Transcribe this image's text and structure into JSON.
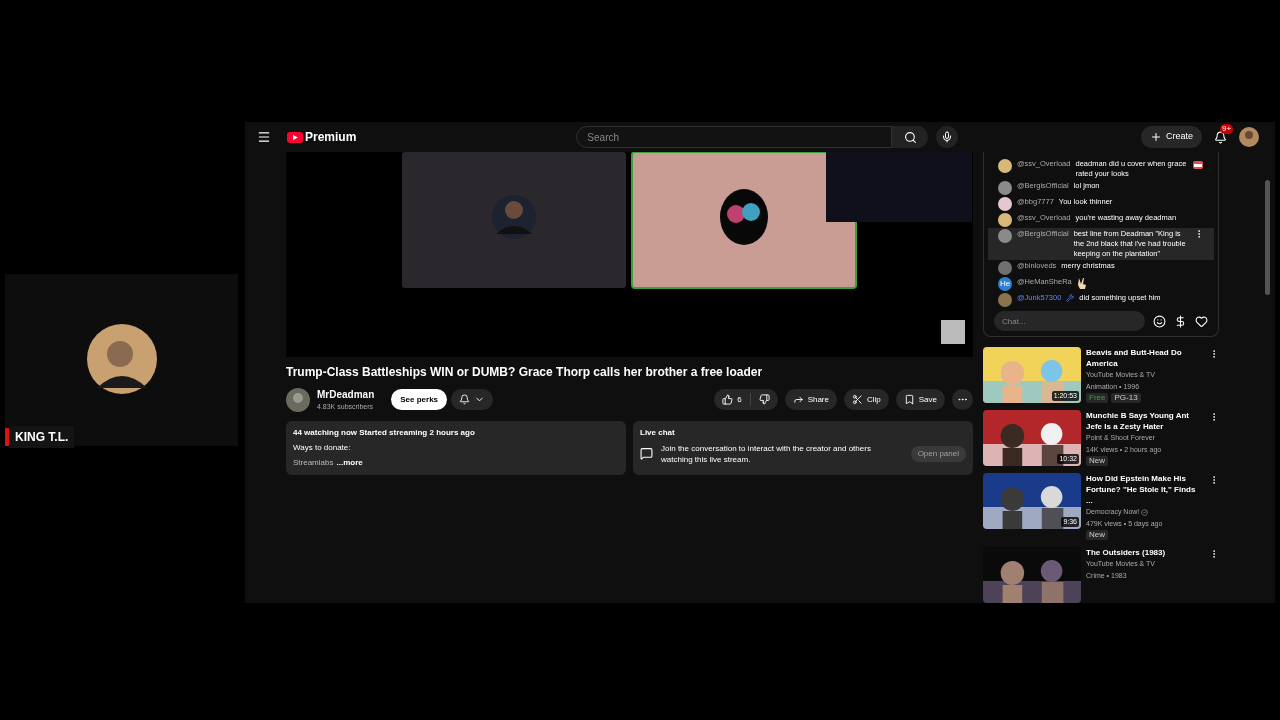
{
  "webcam": {
    "name": "KING T.L."
  },
  "header": {
    "logo": "Premium",
    "search": {
      "placeholder": "Search"
    },
    "create": "Create",
    "notifications": "9+"
  },
  "video": {
    "title": "Trump-Class Battleships WIN or DUMB? Grace Thorp calls her brother a free loader",
    "channel": "MrDeadman",
    "subscribers": "4.83K subscribers",
    "perks": "See perks",
    "likes": "6",
    "actions": [
      "Share",
      "Clip",
      "Save"
    ]
  },
  "description": {
    "stats": "44 watching now  Started streaming 2 hours ago",
    "line": "Ways to donate:",
    "preview": "Streamlabs",
    "more": "...more"
  },
  "live_chat_card": {
    "title": "Live chat",
    "text": "Join the conversation to interact with the creator and others watching this live stream.",
    "button": "Open panel",
    "disabled": true
  },
  "chat": {
    "messages": [
      {
        "author": "@ssv_Overload",
        "text": "deadman did u cover when grace rated your looks",
        "emoji": true,
        "color": "#d8b878",
        "selected": false
      },
      {
        "author": "@BergisOfficial",
        "text": "lol jmon",
        "color": "#8a8a8a",
        "selected": false
      },
      {
        "author": "@bbg7777",
        "text": "You look thinner",
        "color": "#e6c6d0",
        "selected": false
      },
      {
        "author": "@ssv_Overload",
        "text": "you're wasting away deadman",
        "color": "#d8b878",
        "selected": false
      },
      {
        "author": "@BergisOfficial",
        "text": "best line from Deadman \"King is the 2nd black that i've had trouble keeping on the plantation\"",
        "color": "#8a8a8a",
        "selected": true
      },
      {
        "author": "@binloveds",
        "text": "merry christmas",
        "color": "#707070",
        "selected": false
      },
      {
        "author": "@HeManSheRa",
        "initials": "He",
        "emoji": true,
        "color": "#2f7fd0",
        "selected": false
      },
      {
        "author": "@Junk57300",
        "member": true,
        "text": "did something upset him",
        "color": "#8a7450",
        "selected": false
      }
    ],
    "placeholder": "Chat..."
  },
  "recommendations": [
    {
      "title": "Beavis and Butt-Head Do America",
      "channel": "YouTube Movies & TV",
      "meta": "Animation • 1996",
      "duration": "1:20:53",
      "badges": [
        {
          "label": "Free",
          "kind": "free"
        },
        {
          "label": "PG-13",
          "kind": "plain"
        }
      ]
    },
    {
      "title": "Munchie B Says Young Ant Jefe Is a Zesty Hater",
      "channel": "Point & Shoot Forever",
      "meta": "14K views • 2 hours ago",
      "duration": "10:32",
      "badges": [
        {
          "label": "New",
          "kind": "plain"
        }
      ]
    },
    {
      "title": "How Did Epstein Make His Fortune? \"He Stole It,\" Finds ...",
      "channel": "Democracy Now!",
      "verified": true,
      "meta": "479K views • 5 days ago",
      "duration": "9:36",
      "badges": [
        {
          "label": "New",
          "kind": "plain"
        }
      ]
    },
    {
      "title": "The Outsiders (1983)",
      "channel": "YouTube Movies & TV",
      "meta": "Crime • 1983"
    }
  ]
}
